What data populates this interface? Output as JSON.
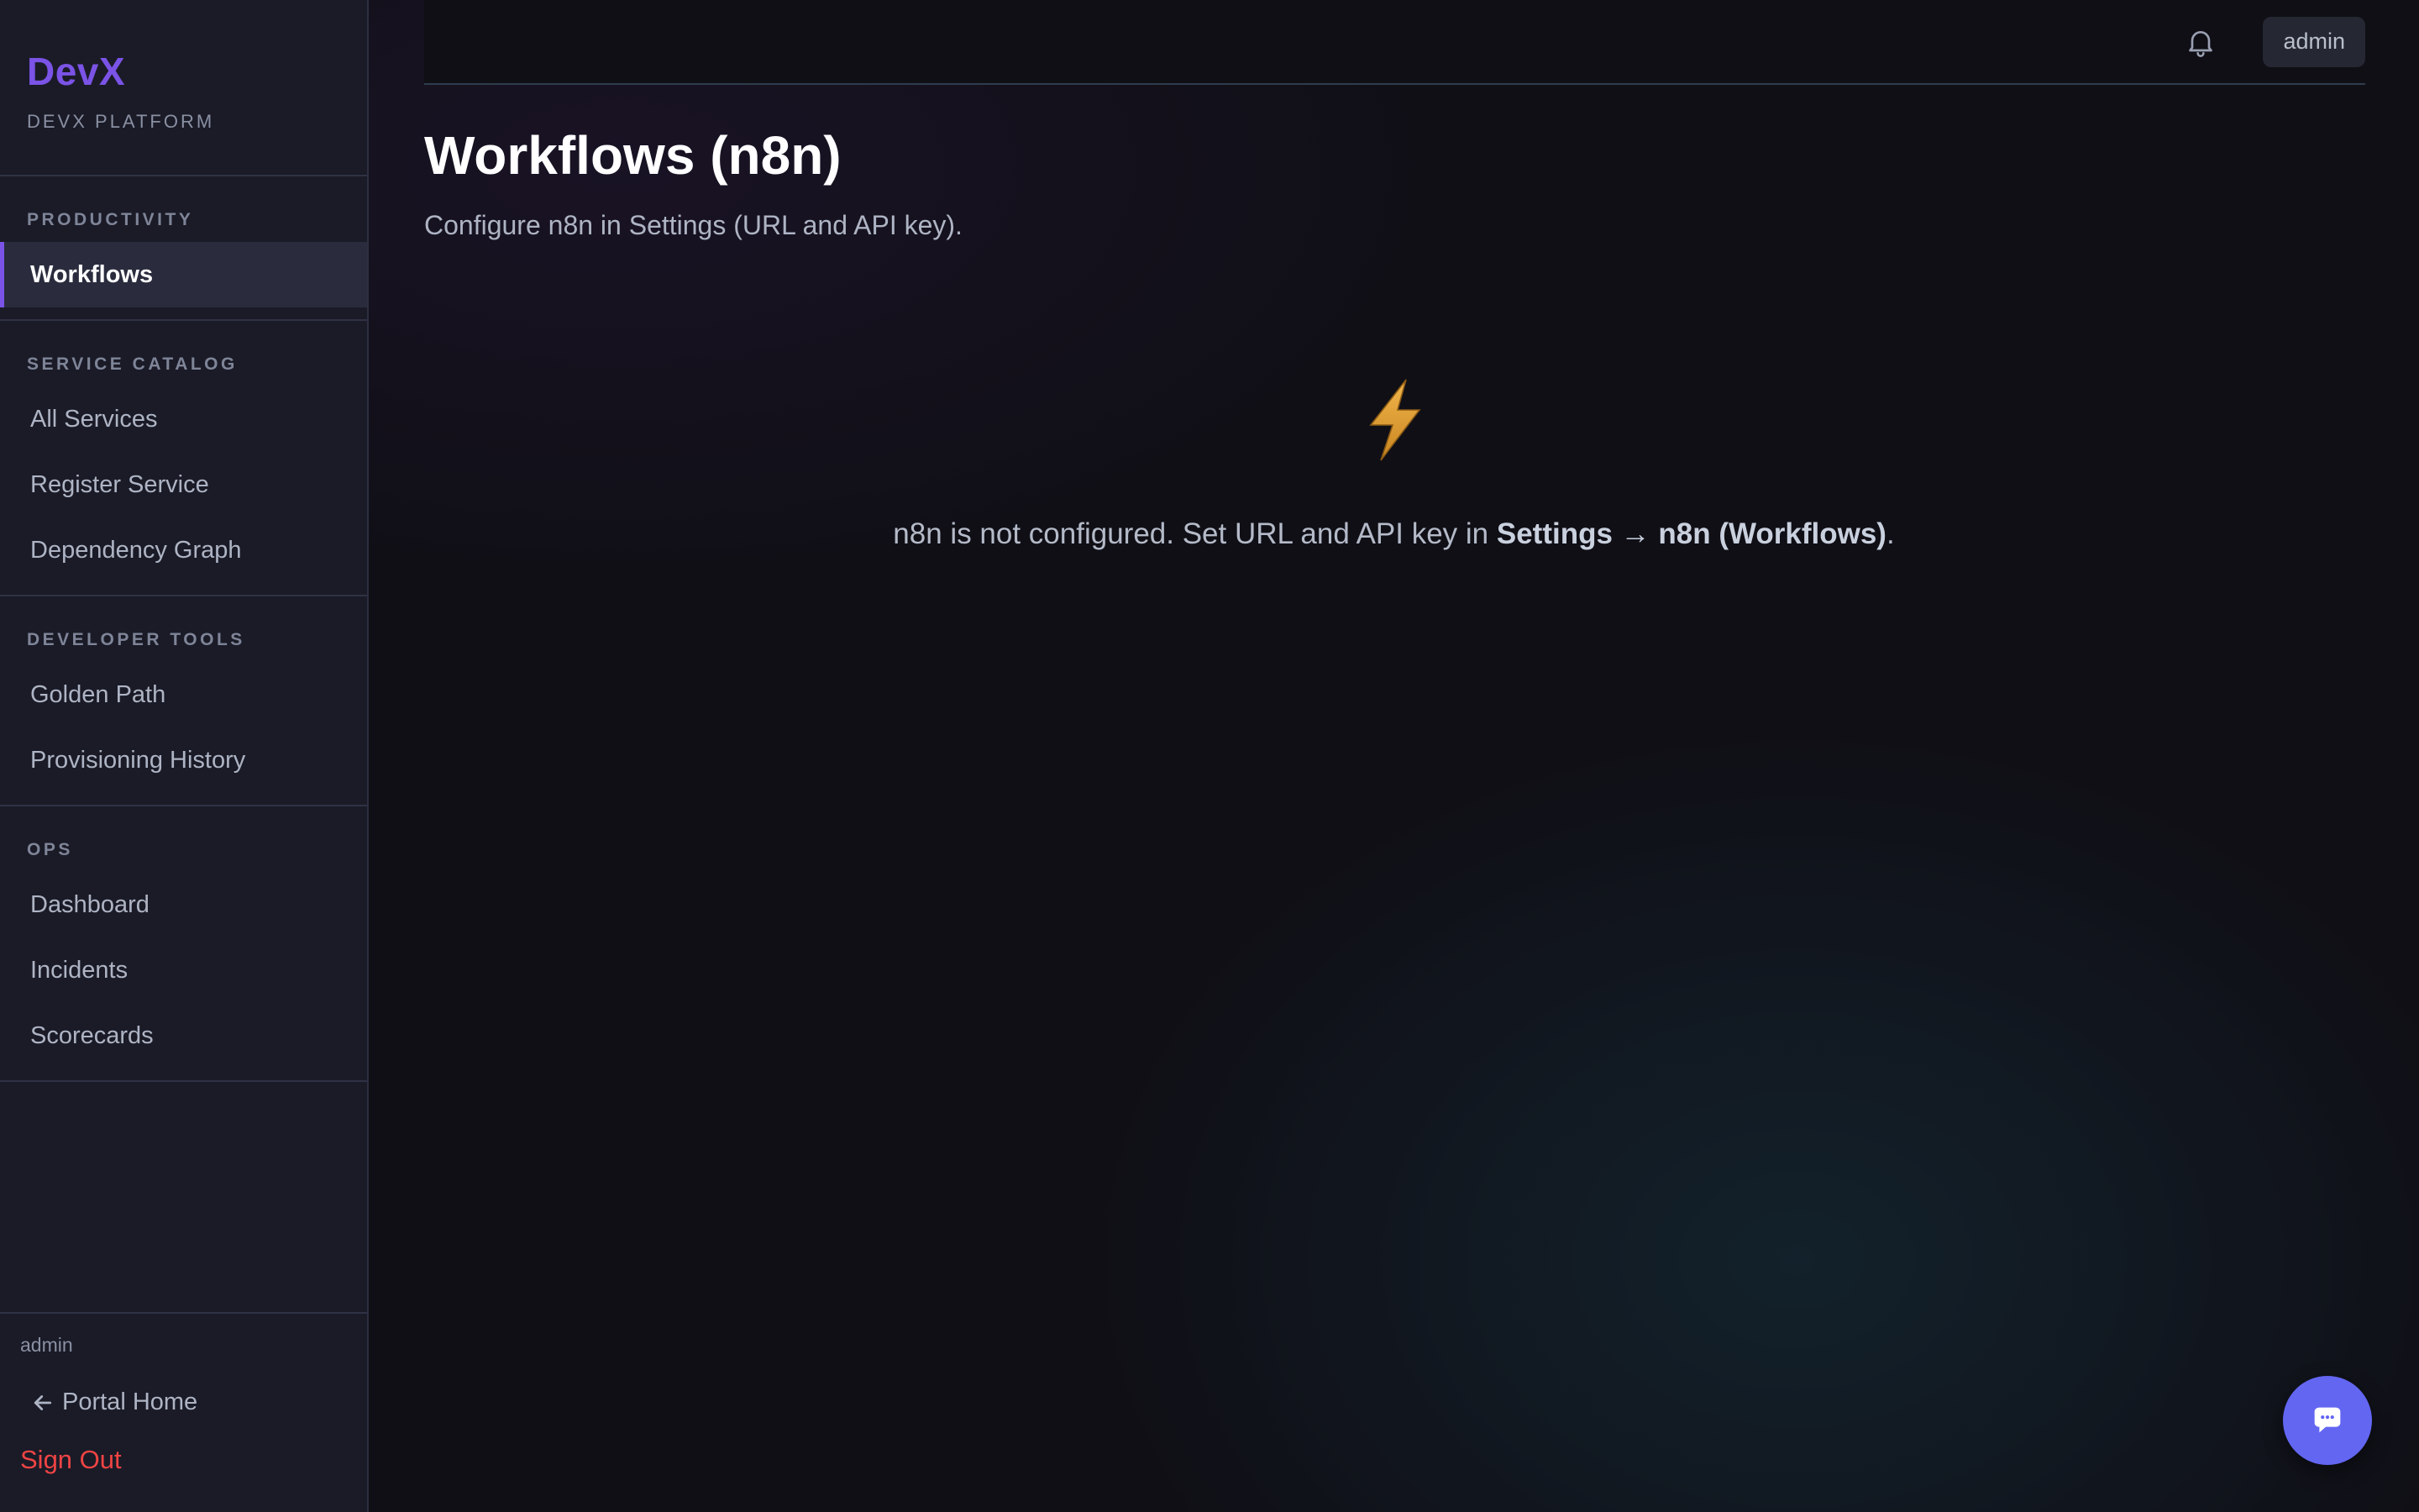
{
  "sidebar": {
    "brand_title": "DevX",
    "brand_subtitle": "DEVX PLATFORM",
    "sections": [
      {
        "label": "PRODUCTIVITY",
        "items": [
          "Workflows"
        ]
      },
      {
        "label": "SERVICE CATALOG",
        "items": [
          "All Services",
          "Register Service",
          "Dependency Graph"
        ]
      },
      {
        "label": "DEVELOPER TOOLS",
        "items": [
          "Golden Path",
          "Provisioning History"
        ]
      },
      {
        "label": "OPS",
        "items": [
          "Dashboard",
          "Incidents",
          "Scorecards"
        ]
      }
    ],
    "active_item": "Workflows",
    "footer": {
      "user": "admin",
      "portal_home": "Portal Home",
      "sign_out": "Sign Out"
    }
  },
  "topbar": {
    "user_label": "admin",
    "bell_icon": "bell-icon"
  },
  "main": {
    "title": "Workflows (n8n)",
    "subtitle": "Configure n8n in Settings (URL and API key).",
    "empty_state": {
      "icon": "lightning-bolt-icon",
      "message_prefix": "n8n is not configured. Set URL and API key in ",
      "message_strong": "Settings → n8n (Workflows)",
      "message_suffix": "."
    }
  },
  "chat_button": {
    "icon": "chat-bubble-icon"
  },
  "colors": {
    "brand": "#7b53e6",
    "sidebar_bg": "#1a1b27",
    "main_bg": "#100f16",
    "danger": "#ef4444",
    "fab": "#6366f1",
    "bolt": "#e0a23b"
  }
}
